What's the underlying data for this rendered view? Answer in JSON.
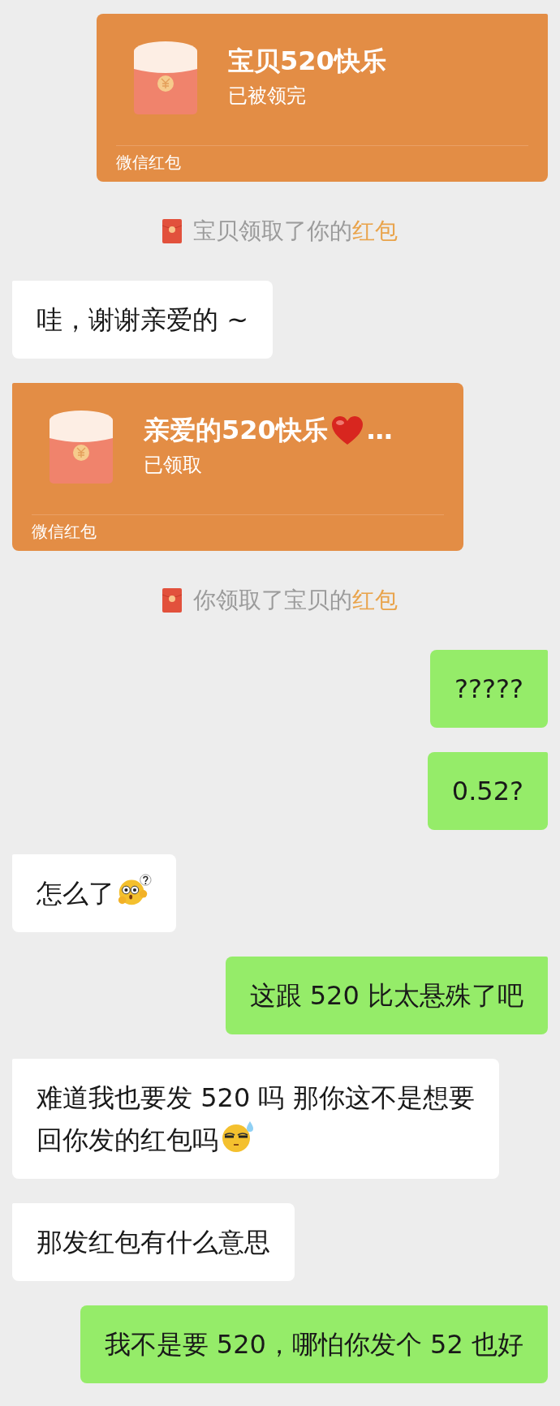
{
  "messages": [
    {
      "kind": "packet",
      "mine": true,
      "title": [
        {
          "kind": "text",
          "text": "宝贝520快乐"
        }
      ],
      "status": "已被领完",
      "footer": "微信红包"
    },
    {
      "kind": "system",
      "text": "宝贝领取了你的",
      "link": "红包"
    },
    {
      "kind": "text",
      "mine": false,
      "parts": [
        {
          "kind": "text",
          "text": "哇，谢谢亲爱的 ~"
        }
      ]
    },
    {
      "kind": "packet",
      "mine": false,
      "title": [
        {
          "kind": "text",
          "text": "亲爱的520快乐"
        },
        {
          "kind": "heart"
        },
        {
          "kind": "text",
          "text": "…"
        }
      ],
      "status": "已领取",
      "footer": "微信红包"
    },
    {
      "kind": "system",
      "text": "你领取了宝贝的",
      "link": "红包"
    },
    {
      "kind": "text",
      "mine": true,
      "parts": [
        {
          "kind": "text",
          "text": "?????"
        }
      ]
    },
    {
      "kind": "text",
      "mine": true,
      "parts": [
        {
          "kind": "text",
          "text": "0.52?"
        }
      ]
    },
    {
      "kind": "text",
      "mine": false,
      "parts": [
        {
          "kind": "text",
          "text": "怎么了"
        },
        {
          "kind": "puzzled"
        }
      ]
    },
    {
      "kind": "text",
      "mine": true,
      "parts": [
        {
          "kind": "text",
          "text": "这跟 520 比太悬殊了吧"
        }
      ]
    },
    {
      "kind": "text",
      "mine": false,
      "parts": [
        {
          "kind": "text",
          "text": "难道我也要发 520 吗 那你这不是想要回你发的红包吗"
        },
        {
          "kind": "sweat"
        }
      ]
    },
    {
      "kind": "text",
      "mine": false,
      "parts": [
        {
          "kind": "text",
          "text": "那发红包有什么意思"
        }
      ]
    },
    {
      "kind": "text",
      "mine": true,
      "parts": [
        {
          "kind": "text",
          "text": "我不是要 520，哪怕你发个 52 也好"
        }
      ]
    }
  ]
}
